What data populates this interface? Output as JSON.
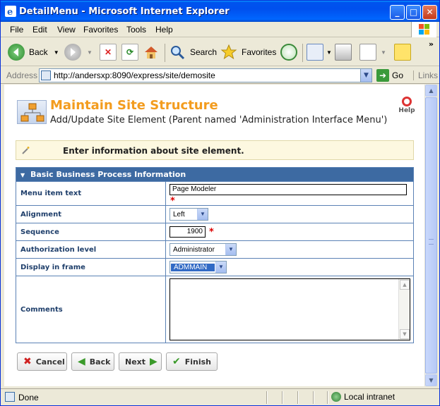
{
  "window": {
    "title": "DetailMenu - Microsoft Internet Explorer"
  },
  "menubar": {
    "items": [
      "File",
      "Edit",
      "View",
      "Favorites",
      "Tools",
      "Help"
    ]
  },
  "toolbar": {
    "back": "Back",
    "search": "Search",
    "favorites": "Favorites"
  },
  "address": {
    "label": "Address",
    "url": "http://andersxp:8090/express/site/demosite",
    "go": "Go",
    "links": "Links"
  },
  "page": {
    "title": "Maintain Site Structure",
    "subtitle": "Add/Update Site Element (Parent named 'Administration Interface Menu')",
    "help": "Help",
    "info": "Enter information about site element."
  },
  "form": {
    "header": "Basic Business Process Information",
    "required_mark": "*",
    "fields": {
      "menu_item_text": {
        "label": "Menu item text",
        "value": "Page Modeler"
      },
      "alignment": {
        "label": "Alignment",
        "value": "Left"
      },
      "sequence": {
        "label": "Sequence",
        "value": "1900"
      },
      "authorization": {
        "label": "Authorization level",
        "value": "Administrator"
      },
      "frame": {
        "label": "Display in frame",
        "value": "ADMMAIN"
      },
      "comments": {
        "label": "Comments",
        "value": ""
      }
    }
  },
  "buttons": {
    "cancel": "Cancel",
    "back": "Back",
    "next": "Next",
    "finish": "Finish"
  },
  "status": {
    "text": "Done",
    "zone": "Local intranet"
  },
  "colors": {
    "title_orange": "#f39c1e",
    "header_blue": "#3d6aa2",
    "label_blue": "#1f3f6b",
    "required_red": "#dd0000"
  }
}
